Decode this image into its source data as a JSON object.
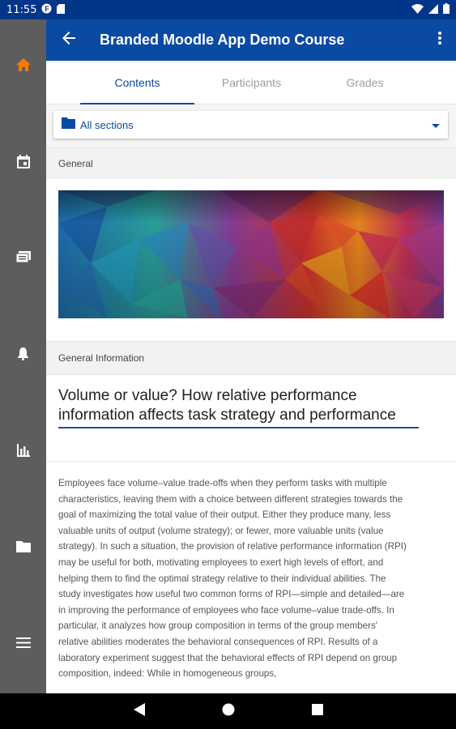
{
  "status_bar": {
    "time": "11:55",
    "left_icons": [
      "f-app-icon",
      "sim-card-icon"
    ],
    "right_icons": [
      "wifi-icon",
      "signal-icon",
      "battery-icon"
    ]
  },
  "sidebar": {
    "items": [
      {
        "name": "home",
        "icon": "home-icon",
        "active": true
      },
      {
        "name": "calendar",
        "icon": "calendar-icon",
        "active": false
      },
      {
        "name": "messages",
        "icon": "messages-icon",
        "active": false
      },
      {
        "name": "notifications",
        "icon": "bell-icon",
        "active": false
      },
      {
        "name": "grades",
        "icon": "bar-chart-icon",
        "active": false
      },
      {
        "name": "files",
        "icon": "folder-icon",
        "active": false
      },
      {
        "name": "menu",
        "icon": "hamburger-menu-icon",
        "active": false
      }
    ]
  },
  "app_bar": {
    "title": "Branded Moodle App Demo Course",
    "back_icon": "arrow-back-icon",
    "more_icon": "more-vert-icon"
  },
  "tabs": [
    {
      "label": "Contents",
      "active": true
    },
    {
      "label": "Participants",
      "active": false
    },
    {
      "label": "Grades",
      "active": false
    }
  ],
  "section_selector": {
    "label": "All sections",
    "icon": "folder-icon"
  },
  "sections": {
    "general": "General",
    "general_information": "General Information"
  },
  "article": {
    "title": "Volume or value? How relative performance information affects task strategy and performance",
    "body": "Employees face volume–value trade-offs when they perform tasks with multiple characteristics, leaving them with a choice between different strategies towards the goal of maximizing the total value of their output. Either they produce many, less valuable units of output (volume strategy); or fewer, more valuable units (value strategy). In such a situation, the provision of relative performance information (RPI) may be useful for both, motivating employees to exert high levels of effort, and helping them to find the optimal strategy relative to their individual abilities. The study investigates how useful two common forms of RPI—simple and detailed—are in improving the performance of employees who face volume–value trade-offs. In particular, it analyzes how group composition in terms of the group members' relative abilities moderates the behavioral consequences of RPI. Results of a laboratory experiment suggest that the behavioral effects of RPI depend on group composition, indeed: While in homogeneous groups,"
  },
  "colors": {
    "status_bar": "#00358a",
    "app_bar": "#0b4aa3",
    "accent": "#0b4aa3",
    "sidebar": "#5d5d5d",
    "home_active": "#f57c00"
  },
  "nav_bar": {
    "icons": [
      "back-triangle-icon",
      "home-circle-icon",
      "recents-square-icon"
    ]
  }
}
